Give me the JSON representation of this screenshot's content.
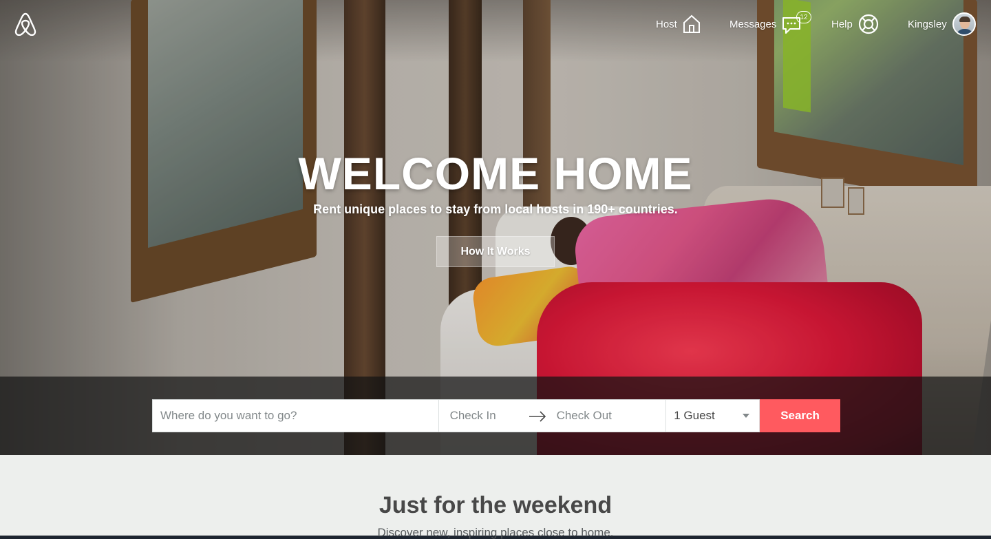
{
  "nav": {
    "logo_icon": "airbnb-logo-icon",
    "host_label": "Host",
    "host_icon": "home-icon",
    "messages_label": "Messages",
    "messages_icon": "chat-bubble-icon",
    "messages_count": "12",
    "help_label": "Help",
    "help_icon": "lifebuoy-icon",
    "user_name": "Kingsley",
    "user_icon": "avatar"
  },
  "hero": {
    "title": "WELCOME HOME",
    "subtitle": "Rent unique places to stay from local hosts in 190+ countries.",
    "cta_label": "How It Works"
  },
  "search": {
    "where_placeholder": "Where do you want to go?",
    "checkin_label": "Check In",
    "checkout_label": "Check Out",
    "arrow_icon": "arrow-right-icon",
    "guests_value": "1 Guest",
    "guests_icon": "caret-down-icon",
    "search_label": "Search"
  },
  "section": {
    "title": "Just for the weekend",
    "subtitle": "Discover new, inspiring places close to home."
  },
  "colors": {
    "accent": "#ff5a5f",
    "section_bg": "#edefed",
    "search_band": "#141414"
  }
}
